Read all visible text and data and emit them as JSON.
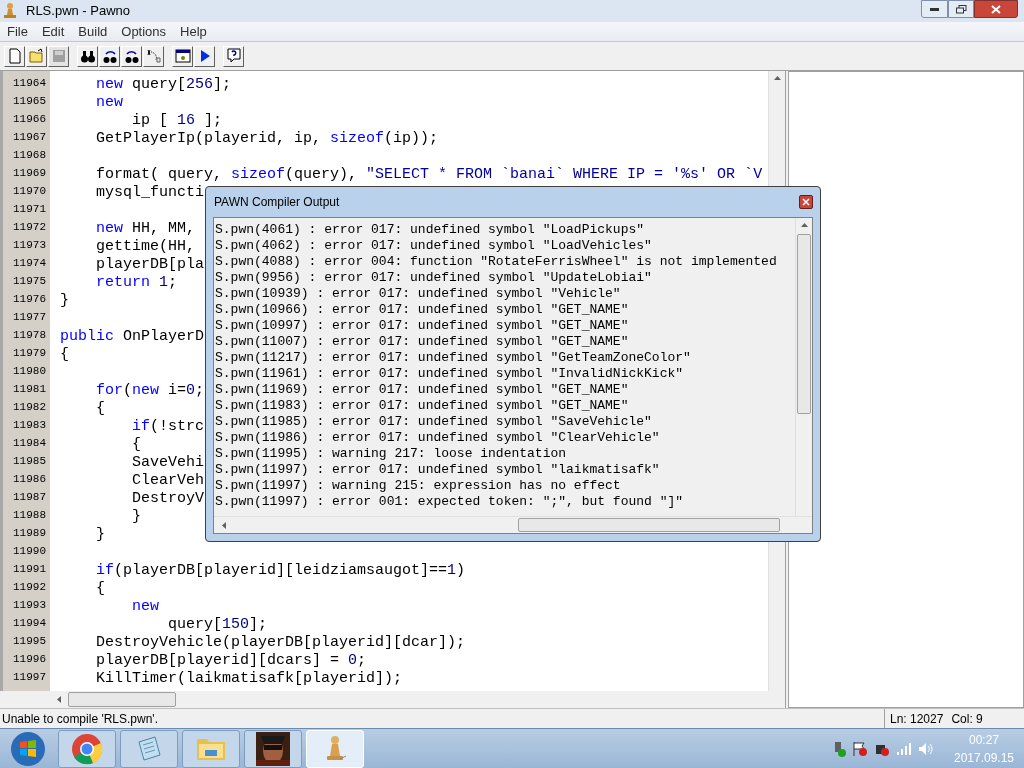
{
  "window": {
    "title": "RLS.pwn - Pawno"
  },
  "menu": [
    "File",
    "Edit",
    "Build",
    "Options",
    "Help"
  ],
  "toolbar_groups": [
    [
      {
        "kind": "new",
        "disabled": false
      },
      {
        "kind": "open",
        "disabled": false
      },
      {
        "kind": "save",
        "disabled": true
      }
    ],
    [
      {
        "kind": "find",
        "disabled": false
      },
      {
        "kind": "find-next",
        "disabled": false
      },
      {
        "kind": "replace",
        "disabled": false
      },
      {
        "kind": "goto",
        "disabled": false
      }
    ],
    [
      {
        "kind": "options",
        "disabled": false
      },
      {
        "kind": "run",
        "disabled": false
      }
    ],
    [
      {
        "kind": "help",
        "disabled": false
      }
    ]
  ],
  "editor": {
    "lines": [
      {
        "number": "11964",
        "kind": "inner",
        "segments": [
          {
            "kind": "keyword",
            "text": "new"
          },
          {
            "kind": "plain",
            "text": " query["
          },
          {
            "kind": "number",
            "text": "256"
          },
          {
            "kind": "plain",
            "text": "];"
          }
        ]
      },
      {
        "number": "11965",
        "kind": "inner",
        "segments": [
          {
            "kind": "keyword",
            "text": "new"
          }
        ]
      },
      {
        "number": "11966",
        "kind": "deeper",
        "segments": [
          {
            "kind": "plain",
            "text": "ip [ "
          },
          {
            "kind": "number",
            "text": "16"
          },
          {
            "kind": "plain",
            "text": " ];"
          }
        ]
      },
      {
        "number": "11967",
        "kind": "inner",
        "segments": [
          {
            "kind": "plain",
            "text": "GetPlayerIp(playerid, ip, "
          },
          {
            "kind": "keyword",
            "text": "sizeof"
          },
          {
            "kind": "plain",
            "text": "(ip));"
          }
        ]
      },
      {
        "number": "11968"
      },
      {
        "number": "11969",
        "kind": "inner",
        "segments": [
          {
            "kind": "plain",
            "text": "format( query, "
          },
          {
            "kind": "keyword",
            "text": "sizeof"
          },
          {
            "kind": "plain",
            "text": "(query), "
          },
          {
            "kind": "string",
            "text": "\"SELECT * FROM `banai` WHERE IP = '%s' OR `V"
          }
        ]
      },
      {
        "number": "11970",
        "kind": "inner",
        "segments": [
          {
            "kind": "plain",
            "text": "mysql_functi"
          }
        ]
      },
      {
        "number": "11971"
      },
      {
        "number": "11972",
        "kind": "inner",
        "segments": [
          {
            "kind": "keyword",
            "text": "new"
          },
          {
            "kind": "plain",
            "text": " HH, MM,"
          }
        ]
      },
      {
        "number": "11973",
        "kind": "inner",
        "segments": [
          {
            "kind": "plain",
            "text": "gettime(HH,"
          }
        ]
      },
      {
        "number": "11974",
        "kind": "inner",
        "segments": [
          {
            "kind": "plain",
            "text": "playerDB[pla"
          }
        ]
      },
      {
        "number": "11975",
        "kind": "inner",
        "segments": [
          {
            "kind": "keyword",
            "text": "return"
          },
          {
            "kind": "number",
            "text": " 1"
          },
          {
            "kind": "plain",
            "text": ";"
          }
        ]
      },
      {
        "number": "11976",
        "kind": "flush",
        "segments": [
          {
            "kind": "plain",
            "text": "}"
          }
        ]
      },
      {
        "number": "11977"
      },
      {
        "number": "11978",
        "kind": "flush",
        "segments": [
          {
            "kind": "keyword",
            "text": "public"
          },
          {
            "kind": "plain",
            "text": " OnPlayerD"
          }
        ]
      },
      {
        "number": "11979",
        "kind": "flush",
        "segments": [
          {
            "kind": "plain",
            "text": "{"
          }
        ]
      },
      {
        "number": "11980"
      },
      {
        "number": "11981",
        "kind": "inner",
        "segments": [
          {
            "kind": "keyword",
            "text": "for"
          },
          {
            "kind": "plain",
            "text": "("
          },
          {
            "kind": "keyword",
            "text": "new"
          },
          {
            "kind": "plain",
            "text": " i="
          },
          {
            "kind": "number",
            "text": "0"
          },
          {
            "kind": "plain",
            "text": ";"
          }
        ]
      },
      {
        "number": "11982",
        "kind": "inner",
        "segments": [
          {
            "kind": "plain",
            "text": "{"
          }
        ]
      },
      {
        "number": "11983",
        "kind": "deeper",
        "segments": [
          {
            "kind": "keyword",
            "text": "if"
          },
          {
            "kind": "plain",
            "text": "(!strc"
          }
        ]
      },
      {
        "number": "11984",
        "kind": "deeper",
        "segments": [
          {
            "kind": "plain",
            "text": "{"
          }
        ]
      },
      {
        "number": "11985",
        "kind": "deeper",
        "segments": [
          {
            "kind": "plain",
            "text": "SaveVehi"
          }
        ]
      },
      {
        "number": "11986",
        "kind": "deeper",
        "segments": [
          {
            "kind": "plain",
            "text": "ClearVeh"
          }
        ]
      },
      {
        "number": "11987",
        "kind": "deeper",
        "segments": [
          {
            "kind": "plain",
            "text": "DestroyV"
          }
        ]
      },
      {
        "number": "11988",
        "kind": "deeper",
        "segments": [
          {
            "kind": "plain",
            "text": "}"
          }
        ]
      },
      {
        "number": "11989",
        "kind": "inner",
        "segments": [
          {
            "kind": "plain",
            "text": "}"
          }
        ]
      },
      {
        "number": "11990"
      },
      {
        "number": "11991",
        "kind": "inner",
        "segments": [
          {
            "kind": "keyword",
            "text": "if"
          },
          {
            "kind": "plain",
            "text": "(playerDB[playerid][leidziamsaugot]=="
          },
          {
            "kind": "number",
            "text": "1"
          },
          {
            "kind": "plain",
            "text": ")"
          }
        ]
      },
      {
        "number": "11992",
        "kind": "inner",
        "segments": [
          {
            "kind": "plain",
            "text": "{"
          }
        ]
      },
      {
        "number": "11993",
        "kind": "deeper",
        "segments": [
          {
            "kind": "keyword",
            "text": "new"
          }
        ]
      },
      {
        "number": "11994",
        "kind": "deepest",
        "segments": [
          {
            "kind": "plain",
            "text": "query["
          },
          {
            "kind": "number",
            "text": "150"
          },
          {
            "kind": "plain",
            "text": "];"
          }
        ]
      },
      {
        "number": "11995",
        "kind": "inner",
        "segments": [
          {
            "kind": "plain",
            "text": "DestroyVehicle(playerDB[playerid][dcar]);"
          }
        ]
      },
      {
        "number": "11996",
        "kind": "inner",
        "segments": [
          {
            "kind": "plain",
            "text": "playerDB[playerid][dcars] = "
          },
          {
            "kind": "number",
            "text": "0"
          },
          {
            "kind": "plain",
            "text": ";"
          }
        ]
      },
      {
        "number": "11997",
        "kind": "inner",
        "segments": [
          {
            "kind": "plain",
            "text": "KillTimer(laikmatisafk[playerid]);"
          }
        ]
      }
    ]
  },
  "compiler_dialog": {
    "title": "PAWN Compiler Output",
    "messages": [
      "S.pwn(4061) : error 017: undefined symbol \"LoadPickups\"",
      "S.pwn(4062) : error 017: undefined symbol \"LoadVehicles\"",
      "S.pwn(4088) : error 004: function \"RotateFerrisWheel\" is not implemented",
      "S.pwn(9956) : error 017: undefined symbol \"UpdateLobiai\"",
      "S.pwn(10939) : error 017: undefined symbol \"Vehicle\"",
      "S.pwn(10966) : error 017: undefined symbol \"GET_NAME\"",
      "S.pwn(10997) : error 017: undefined symbol \"GET_NAME\"",
      "S.pwn(11007) : error 017: undefined symbol \"GET_NAME\"",
      "S.pwn(11217) : error 017: undefined symbol \"GetTeamZoneColor\"",
      "S.pwn(11961) : error 017: undefined symbol \"InvalidNickKick\"",
      "S.pwn(11969) : error 017: undefined symbol \"GET_NAME\"",
      "S.pwn(11983) : error 017: undefined symbol \"GET_NAME\"",
      "S.pwn(11985) : error 017: undefined symbol \"SaveVehicle\"",
      "S.pwn(11986) : error 017: undefined symbol \"ClearVehicle\"",
      "S.pwn(11995) : warning 217: loose indentation",
      "S.pwn(11997) : error 017: undefined symbol \"laikmatisafk\"",
      "S.pwn(11997) : warning 215: expression has no effect",
      "S.pwn(11997) : error 001: expected token: \";\", but found \"]\""
    ]
  },
  "status_bar": {
    "message": "Unable to compile 'RLS.pwn'.",
    "line": "Ln: 12027",
    "column": "Col: 9"
  },
  "taskbar": {
    "items": [
      {
        "kind": "start",
        "selected": false
      },
      {
        "kind": "browser",
        "selected": false
      },
      {
        "kind": "notepad",
        "selected": false
      },
      {
        "kind": "folder",
        "selected": false
      },
      {
        "kind": "game",
        "selected": false
      },
      {
        "kind": "pawno",
        "selected": true
      }
    ],
    "time": "00:27",
    "date": "2017.09.15"
  }
}
